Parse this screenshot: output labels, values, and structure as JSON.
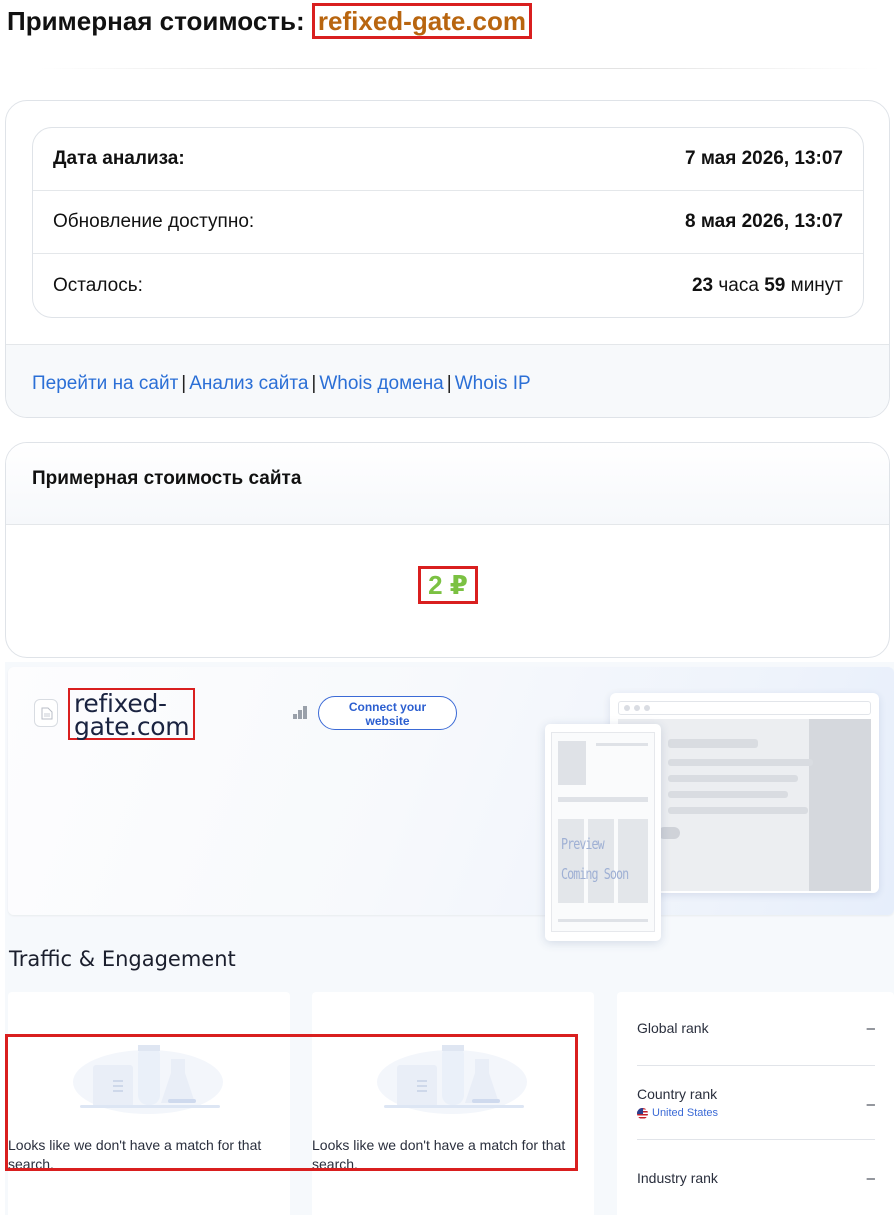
{
  "header": {
    "title_prefix": "Примерная стоимость:",
    "domain": "refixed-gate.com"
  },
  "analysis": {
    "rows": [
      {
        "label": "Дата анализа:",
        "value": "7 мая 2026, 13:07"
      },
      {
        "label": "Обновление доступно:",
        "value": "8 мая 2026, 13:07"
      },
      {
        "label": "Осталось:",
        "hours": "23",
        "hours_unit": "часа",
        "minutes": "59",
        "minutes_unit": "минут"
      }
    ],
    "links": [
      "Перейти на сайт",
      "Анализ сайта",
      "Whois домена",
      "Whois IP"
    ],
    "separator": "|"
  },
  "valuation": {
    "title": "Примерная стоимость сайта",
    "price": "2 ₽",
    "price_color": "#7bc142"
  },
  "similarweb": {
    "domain_line1": "refixed-",
    "domain_line2": "gate.com",
    "connect_line1": "Connect your",
    "connect_line2": "website",
    "preview_line1": "Preview",
    "preview_line2": "Coming Soon",
    "section_title": "Traffic & Engagement",
    "empty_message": "Looks like we don't have a match for that search.",
    "ranks": [
      {
        "label": "Global rank",
        "value": "–"
      },
      {
        "label": "Country rank",
        "value": "–",
        "country": "United States"
      },
      {
        "label": "Industry rank",
        "value": "–"
      }
    ],
    "accent_color": "#3b6ad6"
  },
  "highlight_color": "#d91f1f"
}
